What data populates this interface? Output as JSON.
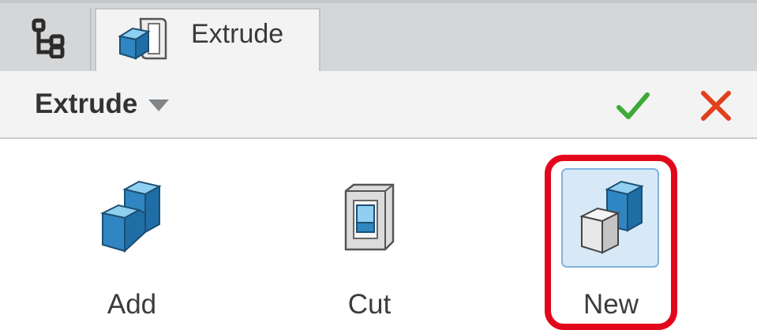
{
  "tabs": [
    {
      "icon": "model-tree-icon",
      "label": ""
    },
    {
      "icon": "extrude-icon",
      "label": "Extrude"
    }
  ],
  "header": {
    "title": "Extrude",
    "ok_icon": "check-icon",
    "cancel_icon": "close-icon"
  },
  "tools": [
    {
      "label": "Add",
      "icon": "extrude-add-icon"
    },
    {
      "label": "Cut",
      "icon": "extrude-cut-icon"
    },
    {
      "label": "New",
      "icon": "extrude-new-icon",
      "selected": true
    }
  ],
  "colors": {
    "ok": "#3daa35",
    "cancel": "#e2401c",
    "highlight": "#e3071b",
    "selected_bg": "#d7e9f7"
  }
}
